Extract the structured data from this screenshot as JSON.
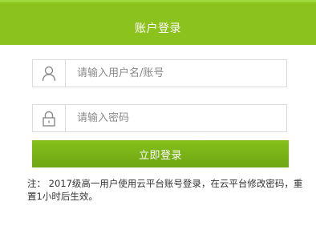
{
  "header": {
    "title": "账户登录"
  },
  "form": {
    "username_placeholder": "请输入用户名/账号",
    "password_placeholder": "请输入密码",
    "username_icon": "user-icon",
    "password_icon": "lock-icon",
    "submit_label": "立即登录"
  },
  "note": {
    "text": "注： 2017级高一用户使用云平台账号登录，在云平台修改密码，重置1小时后生效。"
  },
  "colors": {
    "accent": "#8cc21e",
    "button": "#78b016",
    "border": "#dcdcdc"
  }
}
